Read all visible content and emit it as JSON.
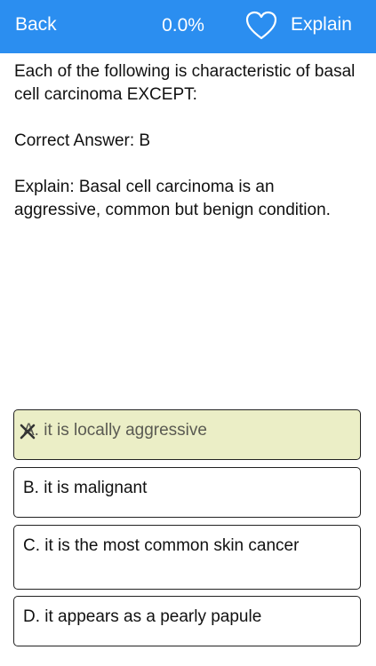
{
  "header": {
    "back_label": "Back",
    "progress": "0.0%",
    "explain_label": "Explain",
    "heart_icon": "heart-outline-icon",
    "bar_color": "#2b8ef0"
  },
  "question": {
    "text": "Each of the following is characteristic of basal cell carcinoma EXCEPT:",
    "correct_answer": "Correct Answer: B",
    "explanation": "Explain: Basal cell carcinoma is an aggressive, common but benign condition."
  },
  "options": [
    {
      "label": "A. it is locally aggressive",
      "selected": true,
      "mark_icon": "x-mark-icon",
      "highlight_color": "#ebeec6"
    },
    {
      "label": "B. it is malignant",
      "selected": false
    },
    {
      "label": "C. it is the most common skin cancer",
      "selected": false
    },
    {
      "label": "D. it appears as a pearly papule",
      "selected": false
    }
  ]
}
